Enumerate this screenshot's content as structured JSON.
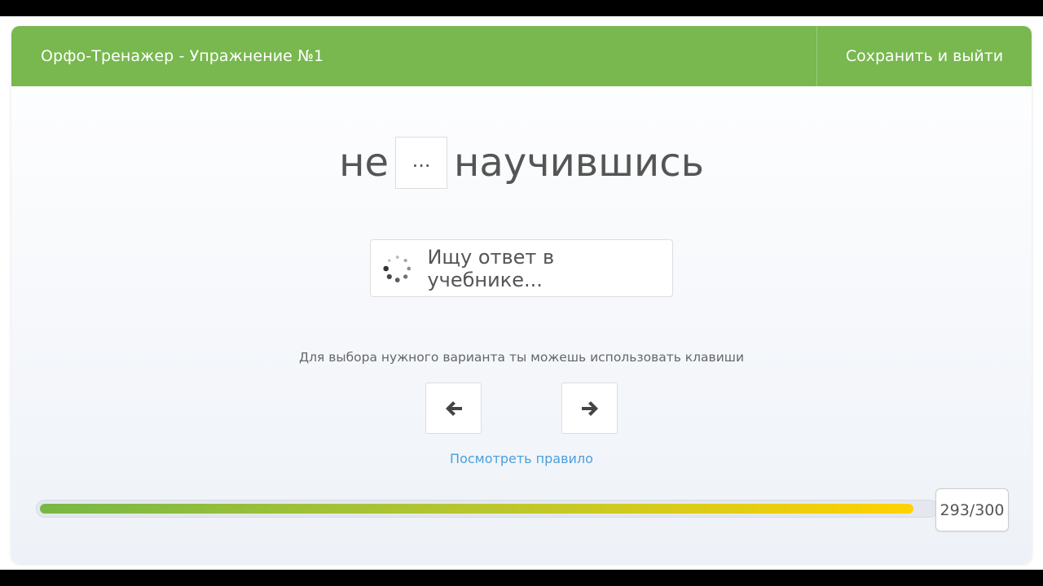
{
  "header": {
    "title": "Орфо-Тренажер - Упражнение №1",
    "save_exit_label": "Сохранить и выйти"
  },
  "exercise": {
    "word_prefix": "не",
    "gap_placeholder": "...",
    "word_suffix": "научившись"
  },
  "answer_button": {
    "label": "Ищу ответ в учебнике...",
    "icon": "loading-spinner-icon"
  },
  "keyboard_hint": {
    "text": "Для выбора нужного варианта ты можешь использовать клавиши",
    "left_key_icon": "arrow-left-icon",
    "right_key_icon": "arrow-right-icon"
  },
  "rule_link": "Посмотреть правило",
  "progress": {
    "current": 293,
    "total": 300,
    "label": "293/300"
  },
  "colors": {
    "header_bg": "#78b84f",
    "link": "#4a9fdc",
    "progress_start": "#76b844",
    "progress_end": "#ffd200"
  }
}
